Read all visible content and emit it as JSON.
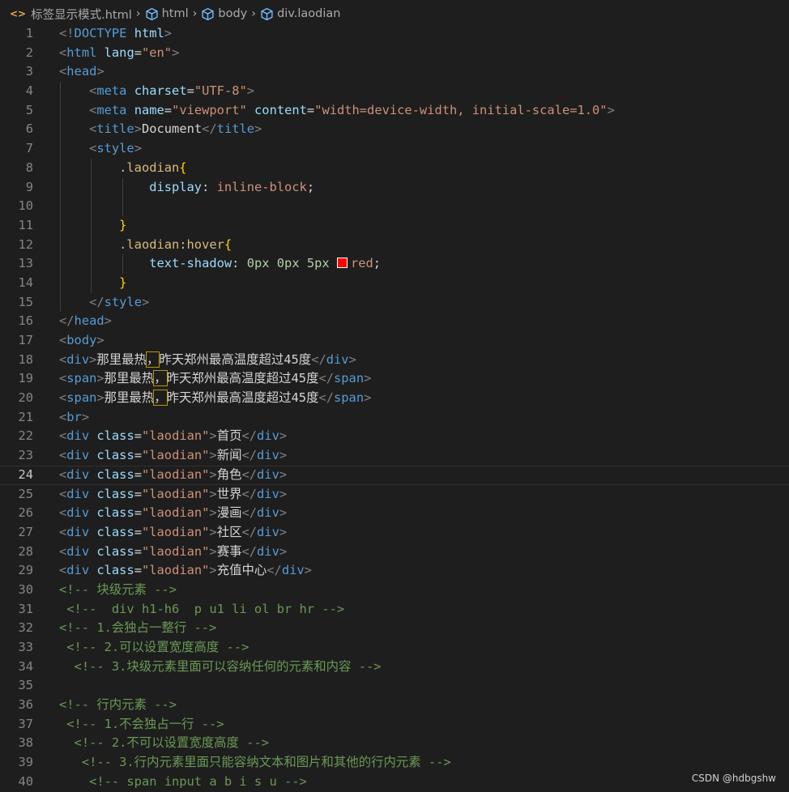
{
  "breadcrumb": {
    "file_icon": "<>",
    "file": "标签显示模式.html",
    "items": [
      "html",
      "body",
      "div.laodian"
    ]
  },
  "current_line": 24,
  "lines": [
    {
      "n": "1",
      "tokens": [
        [
          "br",
          "<!"
        ],
        [
          "tag",
          "DOCTYPE"
        ],
        [
          "text",
          " "
        ],
        [
          "attr",
          "html"
        ],
        [
          "br",
          ">"
        ]
      ]
    },
    {
      "n": "2",
      "tokens": [
        [
          "br",
          "<"
        ],
        [
          "tag",
          "html"
        ],
        [
          "text",
          " "
        ],
        [
          "attr",
          "lang"
        ],
        [
          "text",
          "="
        ],
        [
          "str",
          "\"en\""
        ],
        [
          "br",
          ">"
        ]
      ]
    },
    {
      "n": "3",
      "tokens": [
        [
          "br",
          "<"
        ],
        [
          "tag",
          "head"
        ],
        [
          "br",
          ">"
        ]
      ]
    },
    {
      "n": "4",
      "tokens": [
        [
          "text",
          "    "
        ],
        [
          "br",
          "<"
        ],
        [
          "tag",
          "meta"
        ],
        [
          "text",
          " "
        ],
        [
          "attr",
          "charset"
        ],
        [
          "text",
          "="
        ],
        [
          "str",
          "\"UTF-8\""
        ],
        [
          "br",
          ">"
        ]
      ]
    },
    {
      "n": "5",
      "tokens": [
        [
          "text",
          "    "
        ],
        [
          "br",
          "<"
        ],
        [
          "tag",
          "meta"
        ],
        [
          "text",
          " "
        ],
        [
          "attr",
          "name"
        ],
        [
          "text",
          "="
        ],
        [
          "str",
          "\"viewport\""
        ],
        [
          "text",
          " "
        ],
        [
          "attr",
          "content"
        ],
        [
          "text",
          "="
        ],
        [
          "str",
          "\"width=device-width, initial-scale=1.0\""
        ],
        [
          "br",
          ">"
        ]
      ]
    },
    {
      "n": "6",
      "tokens": [
        [
          "text",
          "    "
        ],
        [
          "br",
          "<"
        ],
        [
          "tag",
          "title"
        ],
        [
          "br",
          ">"
        ],
        [
          "text",
          "Document"
        ],
        [
          "br",
          "</"
        ],
        [
          "tag",
          "title"
        ],
        [
          "br",
          ">"
        ]
      ]
    },
    {
      "n": "7",
      "tokens": [
        [
          "text",
          "    "
        ],
        [
          "br",
          "<"
        ],
        [
          "tag",
          "style"
        ],
        [
          "br",
          ">"
        ]
      ]
    },
    {
      "n": "8",
      "tokens": [
        [
          "text",
          "        "
        ],
        [
          "sel",
          ".laodian"
        ],
        [
          "brace",
          "{"
        ]
      ]
    },
    {
      "n": "9",
      "tokens": [
        [
          "text",
          "            "
        ],
        [
          "prop",
          "display"
        ],
        [
          "text",
          ": "
        ],
        [
          "val",
          "inline-block"
        ],
        [
          "text",
          ";"
        ]
      ]
    },
    {
      "n": "10",
      "tokens": []
    },
    {
      "n": "11",
      "tokens": [
        [
          "text",
          "        "
        ],
        [
          "brace",
          "}"
        ]
      ]
    },
    {
      "n": "12",
      "tokens": [
        [
          "text",
          "        "
        ],
        [
          "sel",
          ".laodian:hover"
        ],
        [
          "brace",
          "{"
        ]
      ]
    },
    {
      "n": "13",
      "tokens": [
        [
          "text",
          "            "
        ],
        [
          "prop",
          "text-shadow"
        ],
        [
          "text",
          ": "
        ],
        [
          "num",
          "0px"
        ],
        [
          "text",
          " "
        ],
        [
          "num",
          "0px"
        ],
        [
          "text",
          " "
        ],
        [
          "num",
          "5px"
        ],
        [
          "text",
          " "
        ],
        [
          "swatch",
          "#ff0000"
        ],
        [
          "val",
          "red"
        ],
        [
          "text",
          ";"
        ]
      ]
    },
    {
      "n": "14",
      "tokens": [
        [
          "text",
          "        "
        ],
        [
          "brace",
          "}"
        ]
      ]
    },
    {
      "n": "15",
      "tokens": [
        [
          "text",
          "    "
        ],
        [
          "br",
          "</"
        ],
        [
          "tag",
          "style"
        ],
        [
          "br",
          ">"
        ]
      ]
    },
    {
      "n": "16",
      "tokens": [
        [
          "br",
          "</"
        ],
        [
          "tag",
          "head"
        ],
        [
          "br",
          ">"
        ]
      ]
    },
    {
      "n": "17",
      "tokens": [
        [
          "br",
          "<"
        ],
        [
          "tag",
          "body"
        ],
        [
          "br",
          ">"
        ]
      ]
    },
    {
      "n": "18",
      "tokens": [
        [
          "br",
          "<"
        ],
        [
          "tag",
          "div"
        ],
        [
          "br",
          ">"
        ],
        [
          "text",
          "那里最热"
        ],
        [
          "box",
          "，"
        ],
        [
          "text",
          "昨天郑州最高温度超过45度"
        ],
        [
          "br",
          "</"
        ],
        [
          "tag",
          "div"
        ],
        [
          "br",
          ">"
        ]
      ]
    },
    {
      "n": "19",
      "tokens": [
        [
          "br",
          "<"
        ],
        [
          "tag",
          "span"
        ],
        [
          "br",
          ">"
        ],
        [
          "text",
          "那里最热"
        ],
        [
          "box",
          "，"
        ],
        [
          "text",
          "昨天郑州最高温度超过45度"
        ],
        [
          "br",
          "</"
        ],
        [
          "tag",
          "span"
        ],
        [
          "br",
          ">"
        ]
      ]
    },
    {
      "n": "20",
      "tokens": [
        [
          "br",
          "<"
        ],
        [
          "tag",
          "span"
        ],
        [
          "br",
          ">"
        ],
        [
          "text",
          "那里最热"
        ],
        [
          "box",
          "，"
        ],
        [
          "text",
          "昨天郑州最高温度超过45度"
        ],
        [
          "br",
          "</"
        ],
        [
          "tag",
          "span"
        ],
        [
          "br",
          ">"
        ]
      ]
    },
    {
      "n": "21",
      "tokens": [
        [
          "br",
          "<"
        ],
        [
          "tag",
          "br"
        ],
        [
          "br",
          ">"
        ]
      ]
    },
    {
      "n": "22",
      "tokens": [
        [
          "br",
          "<"
        ],
        [
          "tag",
          "div"
        ],
        [
          "text",
          " "
        ],
        [
          "attr",
          "class"
        ],
        [
          "text",
          "="
        ],
        [
          "str",
          "\"laodian\""
        ],
        [
          "br",
          ">"
        ],
        [
          "text",
          "首页"
        ],
        [
          "br",
          "</"
        ],
        [
          "tag",
          "div"
        ],
        [
          "br",
          ">"
        ]
      ]
    },
    {
      "n": "23",
      "tokens": [
        [
          "br",
          "<"
        ],
        [
          "tag",
          "div"
        ],
        [
          "text",
          " "
        ],
        [
          "attr",
          "class"
        ],
        [
          "text",
          "="
        ],
        [
          "str",
          "\"laodian\""
        ],
        [
          "br",
          ">"
        ],
        [
          "text",
          "新闻"
        ],
        [
          "br",
          "</"
        ],
        [
          "tag",
          "div"
        ],
        [
          "br",
          ">"
        ]
      ]
    },
    {
      "n": "24",
      "tokens": [
        [
          "br",
          "<"
        ],
        [
          "tag",
          "div"
        ],
        [
          "text",
          " "
        ],
        [
          "attr",
          "class"
        ],
        [
          "text",
          "="
        ],
        [
          "str",
          "\"laodian\""
        ],
        [
          "br",
          ">"
        ],
        [
          "text",
          "角色"
        ],
        [
          "br",
          "</"
        ],
        [
          "tag",
          "div"
        ],
        [
          "br",
          ">"
        ]
      ]
    },
    {
      "n": "25",
      "tokens": [
        [
          "br",
          "<"
        ],
        [
          "tag",
          "div"
        ],
        [
          "text",
          " "
        ],
        [
          "attr",
          "class"
        ],
        [
          "text",
          "="
        ],
        [
          "str",
          "\"laodian\""
        ],
        [
          "br",
          ">"
        ],
        [
          "text",
          "世界"
        ],
        [
          "br",
          "</"
        ],
        [
          "tag",
          "div"
        ],
        [
          "br",
          ">"
        ]
      ]
    },
    {
      "n": "26",
      "tokens": [
        [
          "br",
          "<"
        ],
        [
          "tag",
          "div"
        ],
        [
          "text",
          " "
        ],
        [
          "attr",
          "class"
        ],
        [
          "text",
          "="
        ],
        [
          "str",
          "\"laodian\""
        ],
        [
          "br",
          ">"
        ],
        [
          "text",
          "漫画"
        ],
        [
          "br",
          "</"
        ],
        [
          "tag",
          "div"
        ],
        [
          "br",
          ">"
        ]
      ]
    },
    {
      "n": "27",
      "tokens": [
        [
          "br",
          "<"
        ],
        [
          "tag",
          "div"
        ],
        [
          "text",
          " "
        ],
        [
          "attr",
          "class"
        ],
        [
          "text",
          "="
        ],
        [
          "str",
          "\"laodian\""
        ],
        [
          "br",
          ">"
        ],
        [
          "text",
          "社区"
        ],
        [
          "br",
          "</"
        ],
        [
          "tag",
          "div"
        ],
        [
          "br",
          ">"
        ]
      ]
    },
    {
      "n": "28",
      "tokens": [
        [
          "br",
          "<"
        ],
        [
          "tag",
          "div"
        ],
        [
          "text",
          " "
        ],
        [
          "attr",
          "class"
        ],
        [
          "text",
          "="
        ],
        [
          "str",
          "\"laodian\""
        ],
        [
          "br",
          ">"
        ],
        [
          "text",
          "赛事"
        ],
        [
          "br",
          "</"
        ],
        [
          "tag",
          "div"
        ],
        [
          "br",
          ">"
        ]
      ]
    },
    {
      "n": "29",
      "tokens": [
        [
          "br",
          "<"
        ],
        [
          "tag",
          "div"
        ],
        [
          "text",
          " "
        ],
        [
          "attr",
          "class"
        ],
        [
          "text",
          "="
        ],
        [
          "str",
          "\"laodian\""
        ],
        [
          "br",
          ">"
        ],
        [
          "text",
          "充值中心"
        ],
        [
          "br",
          "</"
        ],
        [
          "tag",
          "div"
        ],
        [
          "br",
          ">"
        ]
      ]
    },
    {
      "n": "30",
      "tokens": [
        [
          "com",
          "<!-- 块级元素 -->"
        ]
      ]
    },
    {
      "n": "31",
      "tokens": [
        [
          "text",
          " "
        ],
        [
          "com",
          "<!--  div h1-h6  p u1 li ol br hr -->"
        ]
      ]
    },
    {
      "n": "32",
      "tokens": [
        [
          "com",
          "<!-- 1.会独占一整行 -->"
        ]
      ]
    },
    {
      "n": "33",
      "tokens": [
        [
          "text",
          " "
        ],
        [
          "com",
          "<!-- 2.可以设置宽度高度 -->"
        ]
      ]
    },
    {
      "n": "34",
      "tokens": [
        [
          "text",
          "  "
        ],
        [
          "com",
          "<!-- 3.块级元素里面可以容纳任何的元素和内容 -->"
        ]
      ]
    },
    {
      "n": "35",
      "tokens": []
    },
    {
      "n": "36",
      "tokens": [
        [
          "com",
          "<!-- 行内元素 -->"
        ]
      ]
    },
    {
      "n": "37",
      "tokens": [
        [
          "text",
          " "
        ],
        [
          "com",
          "<!-- 1.不会独占一行 -->"
        ]
      ]
    },
    {
      "n": "38",
      "tokens": [
        [
          "text",
          "  "
        ],
        [
          "com",
          "<!-- 2.不可以设置宽度高度 -->"
        ]
      ]
    },
    {
      "n": "39",
      "tokens": [
        [
          "text",
          "   "
        ],
        [
          "com",
          "<!-- 3.行内元素里面只能容纳文本和图片和其他的行内元素 -->"
        ]
      ]
    },
    {
      "n": "40",
      "tokens": [
        [
          "text",
          "    "
        ],
        [
          "com",
          "<!-- span input a b i s u -->"
        ]
      ]
    }
  ],
  "watermark": "CSDN @hdbgshw"
}
